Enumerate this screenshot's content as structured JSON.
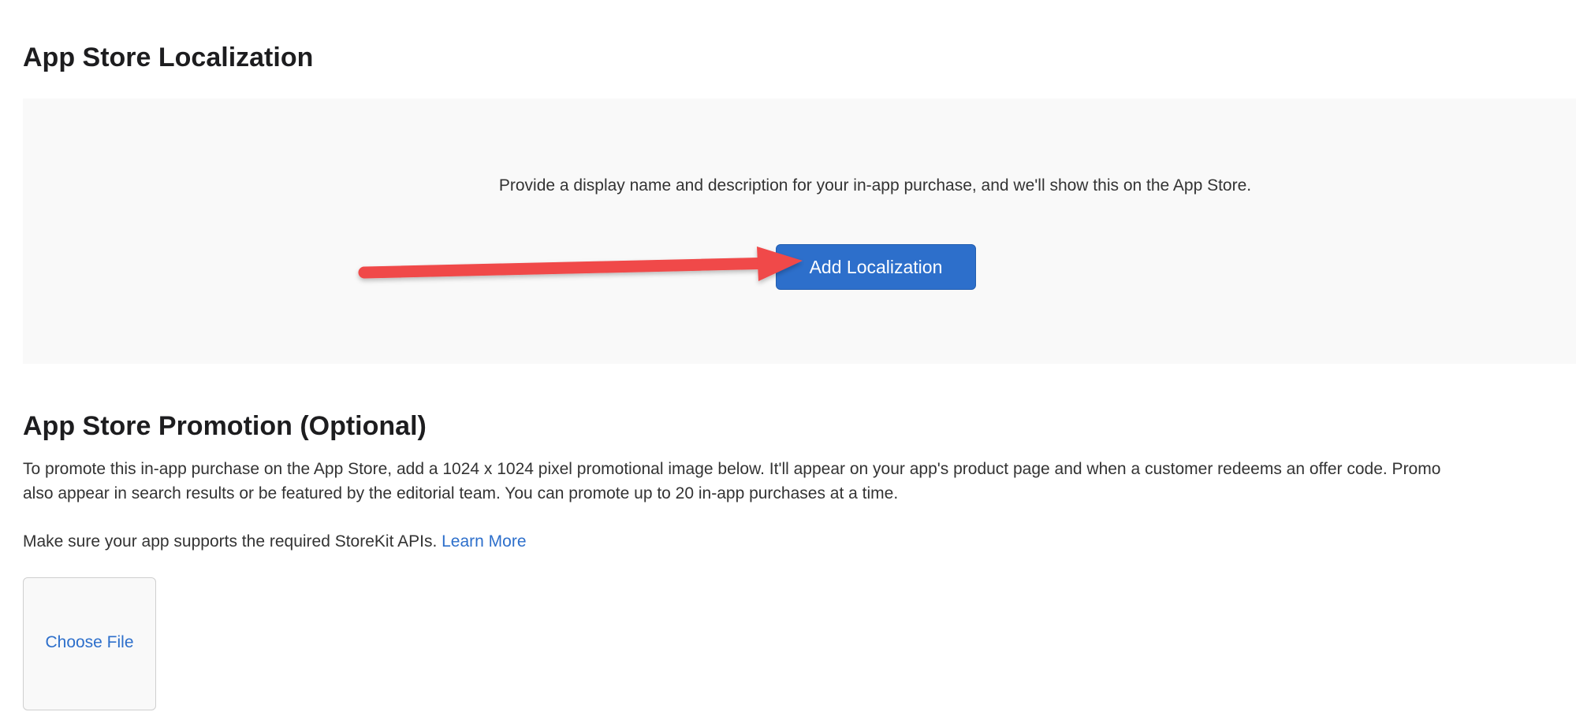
{
  "localization": {
    "title": "App Store Localization",
    "description": "Provide a display name and description for your in-app purchase, and we'll show this on the App Store.",
    "add_button_label": "Add Localization",
    "annotation": {
      "type": "arrow",
      "color": "#f04848",
      "points_to": "add-localization-button"
    }
  },
  "promotion": {
    "title": "App Store Promotion (Optional)",
    "description_line1": "To promote this in-app purchase on the App Store, add a 1024 x 1024 pixel promotional image below. It'll appear on your app's product page and when a customer redeems an offer code. Promo",
    "description_line2": "also appear in search results or be featured by the editorial team. You can promote up to 20 in-app purchases at a time.",
    "storekit_text": "Make sure your app supports the required StoreKit APIs.",
    "learn_more_label": "Learn More",
    "choose_file_label": "Choose File"
  },
  "colors": {
    "accent": "#2d6fcb",
    "panel_background": "#f9f9f9",
    "annotation_arrow": "#f04848"
  }
}
